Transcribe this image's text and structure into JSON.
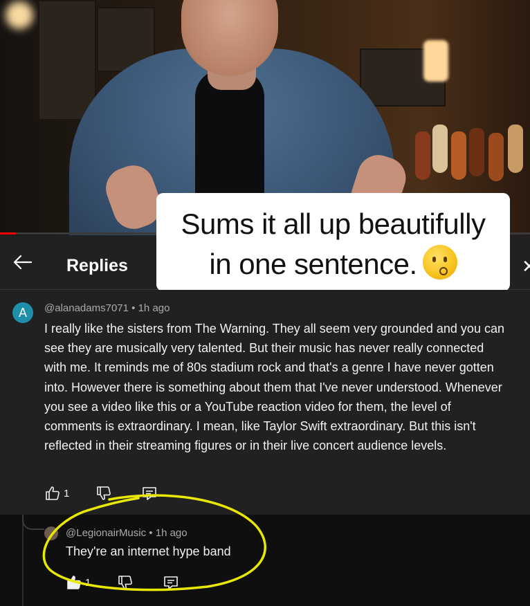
{
  "video": {
    "progress_fraction": 0.03
  },
  "caption": {
    "line1": "Sums it all up beautifully",
    "line2": "in one sentence.",
    "emoji": "kissing-face-emoji"
  },
  "replies_header": {
    "title": "Replies",
    "back_icon": "arrow-left-icon",
    "close_icon": "close-icon"
  },
  "parent_comment": {
    "avatar_letter": "A",
    "author": "@alanadams7071",
    "separator": "•",
    "time": "1h ago",
    "text": "I really like the sisters from The Warning. They all seem very grounded and you can see they are musically very talented. But their music has never really connected with me. It reminds me of 80s stadium rock and that's a genre I have never gotten into. However there is something about them that I've never understood. Whenever you see a video like this or a YouTube reaction video for them, the level of comments is extraordinary. I mean, like Taylor Swift extraordinary. But this isn't reflected in their streaming figures or in their live concert audience levels.",
    "likes": "1"
  },
  "reply": {
    "author": "@LegionairMusic",
    "separator": "•",
    "time": "1h ago",
    "text": "They're an internet hype band",
    "likes": "1"
  },
  "colors": {
    "panel": "#212121",
    "background": "#0f0f0f",
    "annotation": "#e8e800",
    "avatar": "#1e8fa8"
  }
}
